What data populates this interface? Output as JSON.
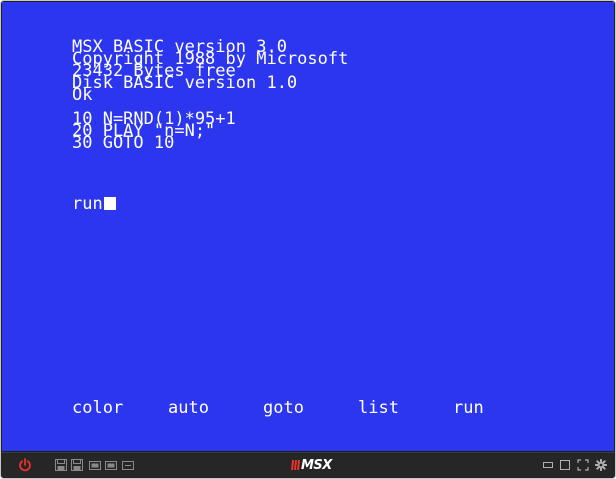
{
  "screen": {
    "lines": [
      "MSX BASIC version 3.0",
      "Copyright 1988 by Microsoft",
      "23432 Bytes free",
      "Disk BASIC version 1.0",
      "Ok",
      "",
      "10 N=RND(1)*95+1",
      "20 PLAY \"n=N;\"",
      "30 GOTO 10",
      ""
    ],
    "prompt": "run"
  },
  "function_keys": [
    "color",
    "auto",
    "goto",
    "list",
    "run"
  ],
  "taskbar": {
    "logo": "MSX",
    "left_icons": [
      "power-icon",
      "floppy-drive-a-icon",
      "floppy-drive-b-icon",
      "cartridge-slot-1-icon",
      "cartridge-slot-2-icon",
      "cassette-icon"
    ],
    "right_icons": [
      "minimize-window-icon",
      "restore-window-icon",
      "fullscreen-icon",
      "settings-icon"
    ]
  },
  "colors": {
    "screen_background": "#2b36ee",
    "screen_text": "#ffffff",
    "taskbar_background": "#262626",
    "power_icon": "#e8322a",
    "logo_accent": "#e8322a"
  }
}
